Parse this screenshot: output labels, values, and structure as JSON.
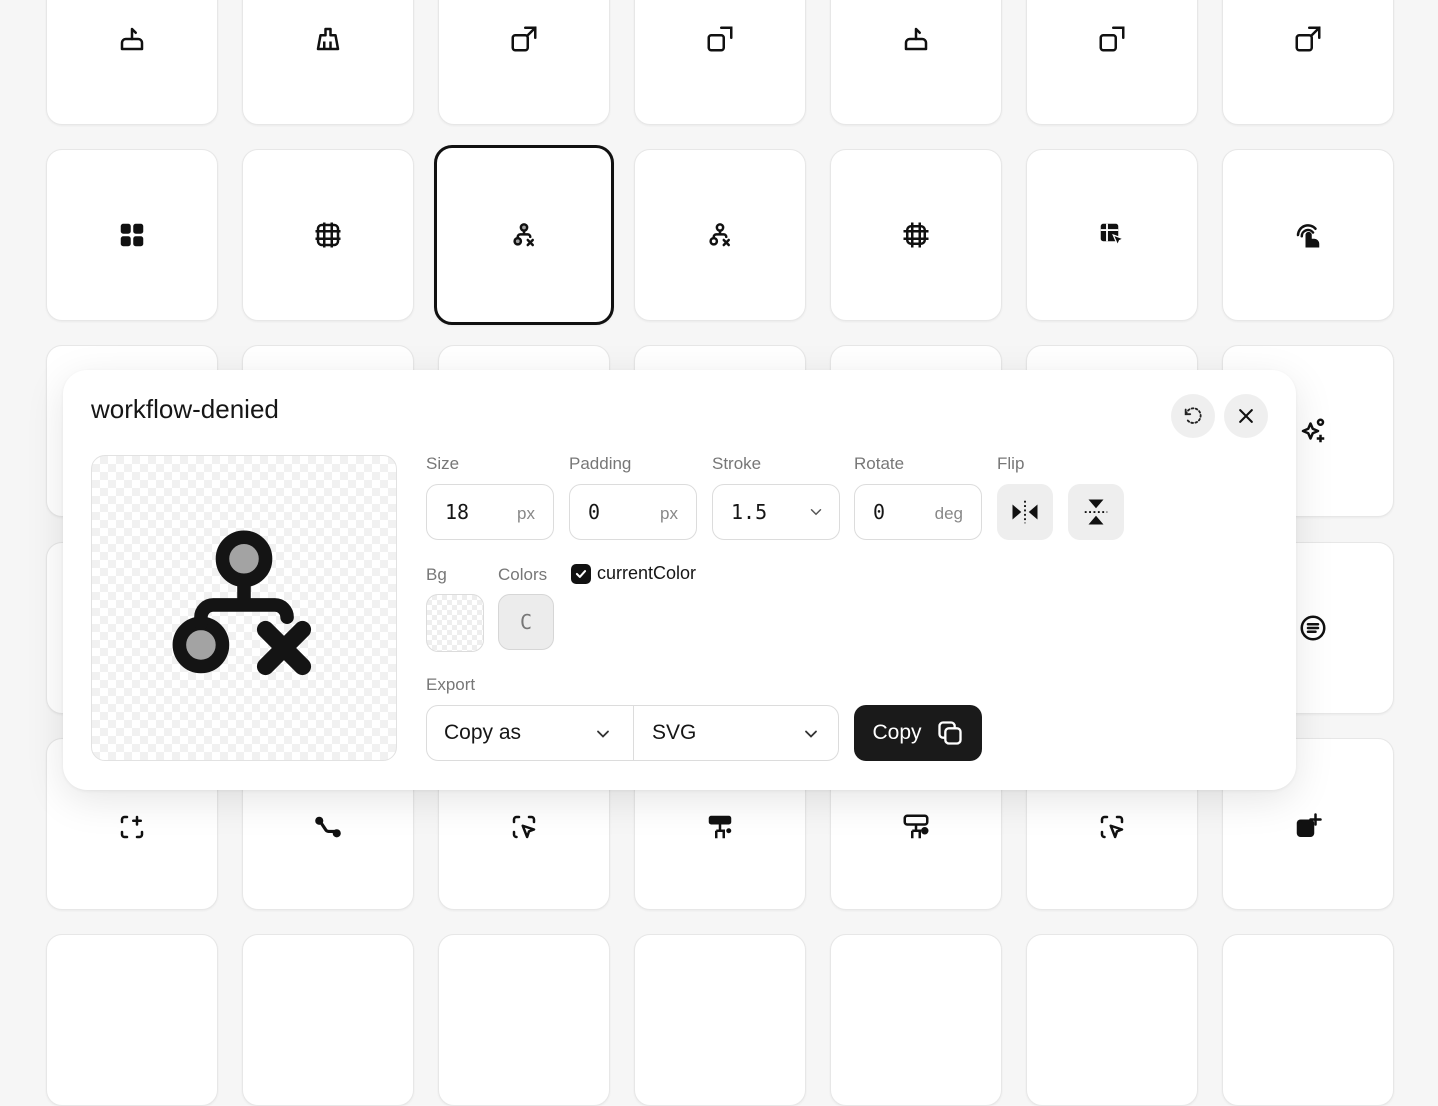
{
  "grid": {
    "row1_icons": [
      "cake-icon",
      "brush-icon",
      "photo-resize-icon",
      "photo-resize-icon",
      "cake-icon",
      "photo-resize-icon",
      "photo-resize-icon"
    ],
    "row2_icons": [
      "grid-filled-icon",
      "grid-outline-icon",
      "workflow-denied-icon",
      "workflow-denied-icon",
      "frame-icon",
      "table-pointer-icon",
      "hand-click-icon"
    ],
    "row5_icons": [
      "frame-plus-icon",
      "route-icon",
      "select-pointer-icon",
      "paint-roller-icon",
      "paint-roller-icon",
      "select-pointer-icon",
      "photo-plus-icon"
    ],
    "side_icons": [
      "sparkles-icon",
      "message-circle-icon"
    ]
  },
  "panel": {
    "title": "workflow-denied",
    "reset_icon": "rotate-icon",
    "close_icon": "close-icon",
    "size": {
      "label": "Size",
      "value": "18",
      "unit": "px"
    },
    "padding": {
      "label": "Padding",
      "value": "0",
      "unit": "px"
    },
    "stroke": {
      "label": "Stroke",
      "value": "1.5"
    },
    "rotate": {
      "label": "Rotate",
      "value": "0",
      "unit": "deg"
    },
    "flip": {
      "label": "Flip",
      "horizontal_icon": "flip-horizontal-icon",
      "vertical_icon": "flip-vertical-icon"
    },
    "bg": {
      "label": "Bg"
    },
    "colors": {
      "label": "Colors",
      "swatch_text": "C"
    },
    "current_color": {
      "label": "currentColor",
      "checked": true
    },
    "export": {
      "label": "Export",
      "copy_as": "Copy as",
      "format": "SVG",
      "copy_label": "Copy"
    }
  },
  "colors": {
    "accent": "#1a1a1a",
    "icon_fill": "#a3a3a3"
  }
}
